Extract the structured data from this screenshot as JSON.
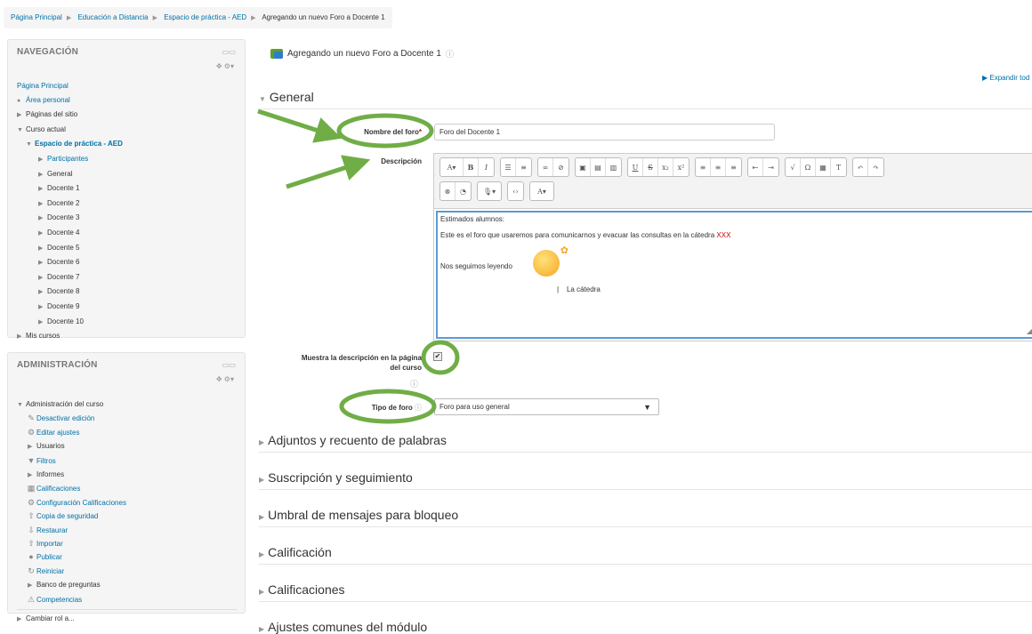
{
  "breadcrumb": [
    "Página Principal",
    "Educación a Distancia",
    "Espacio de práctica - AED",
    "Agregando un nuevo Foro a Docente 1"
  ],
  "nav": {
    "title": "NAVEGACIÓN",
    "home": "Página Principal",
    "personal": "Área personal",
    "site_pages": "Páginas del sitio",
    "current_course": "Curso actual",
    "course": "Espacio de práctica - AED",
    "participants": "Participantes",
    "general": "General",
    "topics": [
      "Docente 1",
      "Docente 2",
      "Docente 3",
      "Docente 4",
      "Docente 5",
      "Docente 6",
      "Docente 7",
      "Docente 8",
      "Docente 9",
      "Docente 10"
    ],
    "my_courses": "Mis cursos"
  },
  "admin": {
    "title": "ADMINISTRACIÓN",
    "course_admin": "Administración del curso",
    "items": [
      {
        "label": "Desactivar edición",
        "icon": "pencil-icon"
      },
      {
        "label": "Editar ajustes",
        "icon": "gear-icon"
      },
      {
        "label": "Usuarios",
        "icon": "expand-arrow-icon"
      },
      {
        "label": "Filtros",
        "icon": "filter-icon"
      },
      {
        "label": "Informes",
        "icon": "expand-arrow-icon"
      },
      {
        "label": "Calificaciones",
        "icon": "grades-icon"
      },
      {
        "label": "Configuración Calificaciones",
        "icon": "gear-icon"
      },
      {
        "label": "Copia de seguridad",
        "icon": "backup-icon"
      },
      {
        "label": "Restaurar",
        "icon": "restore-icon"
      },
      {
        "label": "Importar",
        "icon": "import-icon"
      },
      {
        "label": "Publicar",
        "icon": "publish-icon"
      },
      {
        "label": "Reiniciar",
        "icon": "reset-icon"
      },
      {
        "label": "Banco de preguntas",
        "icon": "expand-arrow-icon"
      },
      {
        "label": "Competencias",
        "icon": "competencies-icon"
      }
    ],
    "switch_role": "Cambiar rol a..."
  },
  "page": {
    "title": "Agregando un nuevo Foro a Docente 1",
    "expand_all": "Expandir tod"
  },
  "form": {
    "general": "General",
    "name_label": "Nombre del foro",
    "name_value": "Foro del Docente 1",
    "desc_label": "Descripción",
    "desc_lines": {
      "l1": "Estimados alumnos:",
      "l2a": "Este es el foro que usaremos para comunicarnos y evacuar las consultas en la cátedra ",
      "l2b": "XXX",
      "l3": "Nos seguimos leyendo",
      "sign": "La cátedra"
    },
    "show_desc_label_1": "Muestra la descripción en la página",
    "show_desc_label_2": "del curso",
    "show_desc_checked": "✔",
    "type_label": "Tipo de foro",
    "type_value": "Foro para uso general"
  },
  "sections": [
    "Adjuntos y recuento de palabras",
    "Suscripción y seguimiento",
    "Umbral de mensajes para bloqueo",
    "Calificación",
    "Calificaciones",
    "Ajustes comunes del módulo"
  ],
  "annotation_color": "#70ad47"
}
